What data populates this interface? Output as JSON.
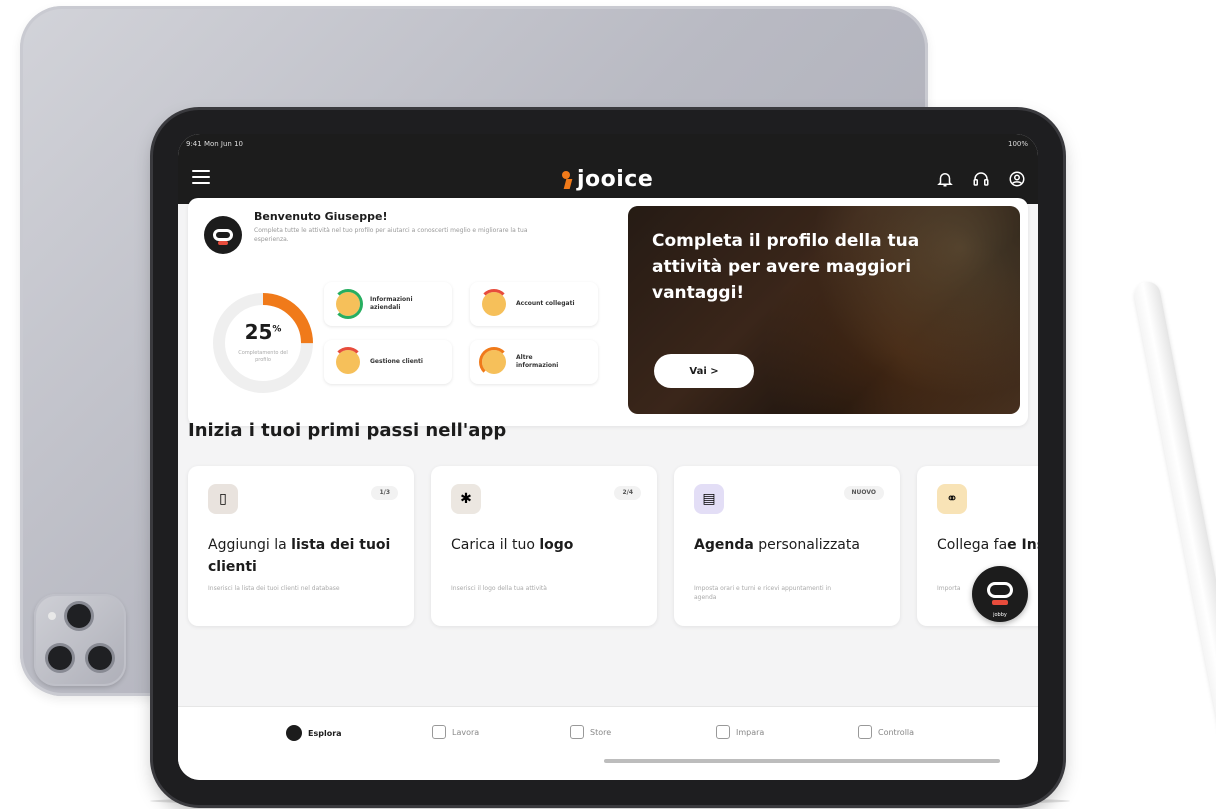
{
  "status_bar": {
    "time": "9:41 Mon Jun 10",
    "indicators": "100%"
  },
  "header": {
    "logo_text": "jooice",
    "icons": [
      "bell-icon",
      "headset-icon",
      "user-icon"
    ]
  },
  "welcome": {
    "title": "Benvenuto Giuseppe!",
    "text": "Completa tutte le attività nel tuo profilo per aiutarci a conoscerti meglio e migliorare la tua esperienza.",
    "progress": {
      "value": "25",
      "unit": "%",
      "caption": "Completamento del profilo"
    },
    "tasks": [
      {
        "label": "Informazioni aziendali",
        "status": "green"
      },
      {
        "label": "Account collegati",
        "status": "red"
      },
      {
        "label": "Gestione clienti",
        "status": "red"
      },
      {
        "label": "Altre informazioni",
        "status": "orange"
      }
    ]
  },
  "promo": {
    "text": "Completa il profilo della tua attività per avere maggiori vantaggi!",
    "button": "Vai >"
  },
  "steps_section": {
    "title": "Inizia i tuoi primi passi nell'app",
    "cards": [
      {
        "badge": "1/3",
        "title_a": "Aggiungi la ",
        "title_b": "lista dei tuoi clienti",
        "desc": "Inserisci la lista dei tuoi clienti nel database",
        "icon_color": "#e9e3de"
      },
      {
        "badge": "2/4",
        "title_a": "Carica il tuo ",
        "title_b": "logo",
        "desc": "Inserisci il logo della tua attività",
        "icon_color": "#ece7e1"
      },
      {
        "badge": "NUOVO",
        "title_a": "Agenda",
        "title_b": " personalizzata",
        "desc": "Imposta orari e turni e ricevi appuntamenti in agenda",
        "icon_color": "#e3def6"
      },
      {
        "badge": "",
        "title_a": "Collega fa",
        "title_b": "e Ins",
        "desc": "Importa",
        "icon_color": "#f8e3b6"
      }
    ]
  },
  "assistant": {
    "label": "jobby"
  },
  "bottom_nav": [
    {
      "label": "Esplora",
      "active": true
    },
    {
      "label": "Lavora",
      "active": false
    },
    {
      "label": "Store",
      "active": false
    },
    {
      "label": "Impara",
      "active": false
    },
    {
      "label": "Controlla",
      "active": false
    }
  ],
  "colors": {
    "brand_orange": "#f07a1a",
    "dark": "#1c1c1c",
    "accent_red": "#e74c3c",
    "green": "#27ae60"
  }
}
